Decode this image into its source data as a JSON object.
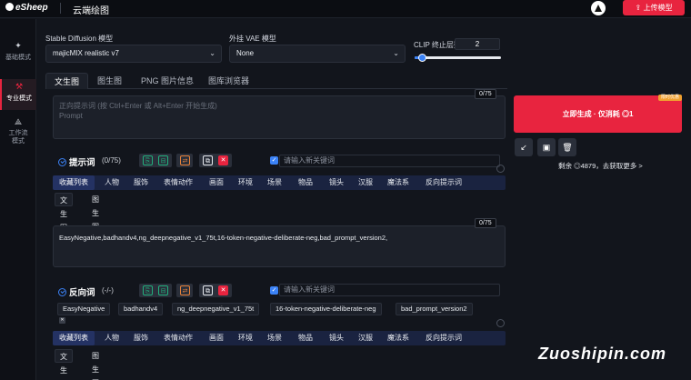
{
  "topbar": {
    "logo": "eSheep",
    "app_title": "云端绘图",
    "upload_button": "上传模型"
  },
  "sidebar": {
    "items": [
      {
        "label": "基础模式",
        "icon": "sparkle-icon",
        "active": false
      },
      {
        "label": "专业模式",
        "icon": "wand-icon",
        "active": true
      },
      {
        "label": "工作流模式",
        "icon": "workflow-icon",
        "active": false
      }
    ]
  },
  "models": {
    "sd_label": "Stable Diffusion 模型",
    "sd_value": "majicMIX realistic v7",
    "vae_label": "外挂 VAE 模型",
    "vae_value": "None",
    "clip_label": "CLIP 终止层数",
    "clip_value": "2",
    "clip_slider_fraction": 0.08
  },
  "tabs": [
    "文生图",
    "图生图",
    "PNG 图片信息",
    "图库浏览器"
  ],
  "positive": {
    "placeholder_line1": "正向提示词 (按 Ctrl+Enter 或 Alt+Enter 开始生成)",
    "placeholder_line2": "Prompt",
    "counter": "0/75",
    "section_title": "提示词",
    "section_count": "(0/75)",
    "keyword_placeholder": "请输入新关键词"
  },
  "categories": [
    "收藏列表",
    "人物",
    "服饰",
    "表情动作",
    "画面",
    "环境",
    "场景",
    "物品",
    "镜头",
    "汉服",
    "魔法系",
    "反向提示词"
  ],
  "sub_tabs": [
    "文生图",
    "图生图"
  ],
  "negative": {
    "counter": "0/75",
    "text": "EasyNegative,badhandv4,ng_deepnegative_v1_75t,16-token-negative-deliberate-neg,bad_prompt_version2,",
    "section_title": "反向词",
    "section_count": "(-/-)",
    "keyword_placeholder": "请输入新关键词",
    "tags": [
      "EasyNegative",
      "badhandv4",
      "ng_deepnegative_v1_75t",
      "16-token-negative-deliberate-neg",
      "bad_prompt_version2"
    ]
  },
  "generate": {
    "button": "立即生成 · 仅消耗 ◎1",
    "badge": "限时优惠",
    "remaining": "剩余 ◎4879，去获取更多 >"
  },
  "watermark": "Zuoshipin.com"
}
